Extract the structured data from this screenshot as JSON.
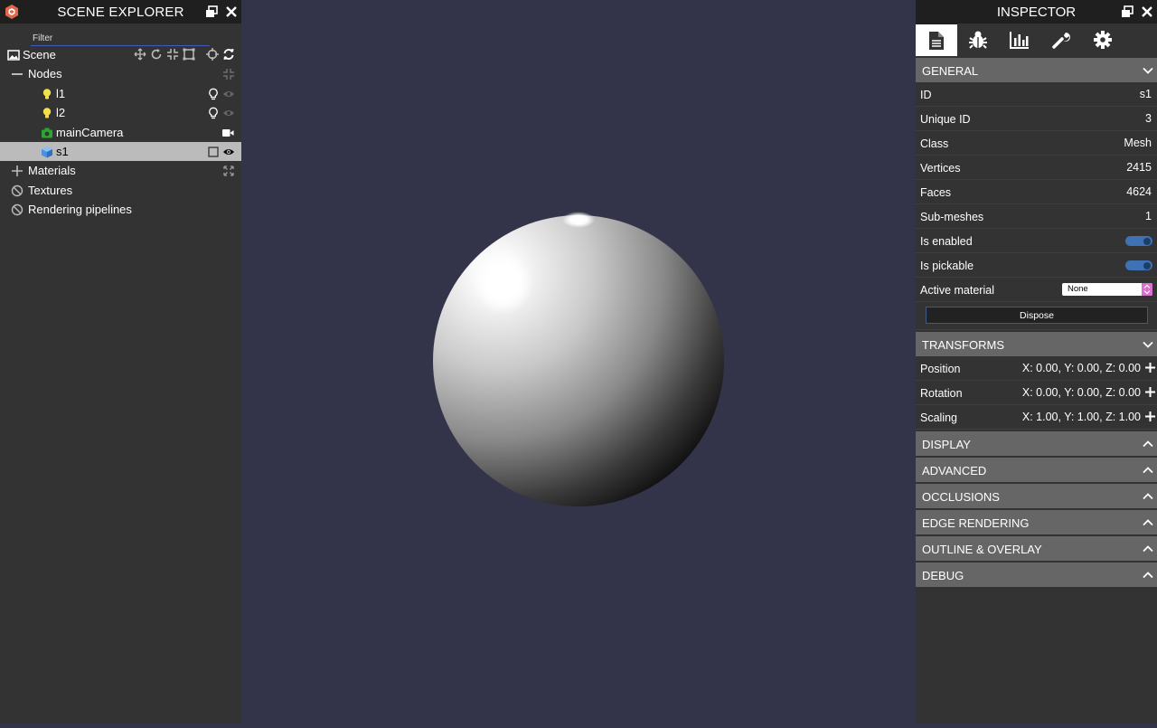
{
  "scene_explorer": {
    "title": "SCENE EXPLORER",
    "filter_placeholder": "Filter",
    "scene_label": "Scene",
    "nodes_label": "Nodes",
    "nodes": [
      {
        "label": "l1",
        "type": "light"
      },
      {
        "label": "l2",
        "type": "light"
      },
      {
        "label": "mainCamera",
        "type": "camera"
      },
      {
        "label": "s1",
        "type": "mesh",
        "selected": true
      }
    ],
    "materials_label": "Materials",
    "textures_label": "Textures",
    "pipelines_label": "Rendering pipelines"
  },
  "inspector": {
    "title": "INSPECTOR",
    "tabs": [
      "properties-icon",
      "debug-icon",
      "statistics-icon",
      "tools-icon",
      "settings-icon"
    ],
    "general": {
      "header": "GENERAL",
      "id_label": "ID",
      "id_value": "s1",
      "uid_label": "Unique ID",
      "uid_value": "3",
      "class_label": "Class",
      "class_value": "Mesh",
      "vertices_label": "Vertices",
      "vertices_value": "2415",
      "faces_label": "Faces",
      "faces_value": "4624",
      "submeshes_label": "Sub-meshes",
      "submeshes_value": "1",
      "enabled_label": "Is enabled",
      "pickable_label": "Is pickable",
      "material_label": "Active material",
      "material_value": "None",
      "dispose_label": "Dispose"
    },
    "transforms": {
      "header": "TRANSFORMS",
      "position_label": "Position",
      "position_value": "X: 0.00, Y: 0.00, Z: 0.00",
      "rotation_label": "Rotation",
      "rotation_value": "X: 0.00, Y: 0.00, Z: 0.00",
      "scaling_label": "Scaling",
      "scaling_value": "X: 1.00, Y: 1.00, Z: 1.00"
    },
    "sections": [
      "DISPLAY",
      "ADVANCED",
      "OCCLUSIONS",
      "EDGE RENDERING",
      "OUTLINE & OVERLAY",
      "DEBUG"
    ]
  },
  "colors": {
    "panel_bg": "#333333",
    "header_bg": "#1f1f1f",
    "section_bg": "#666666",
    "viewport_bg": "#33334a",
    "toggle": "#3e72b5",
    "light_icon": "#f3e14a",
    "camera_icon": "#27a830",
    "mesh_icon": "#4a90e2"
  }
}
